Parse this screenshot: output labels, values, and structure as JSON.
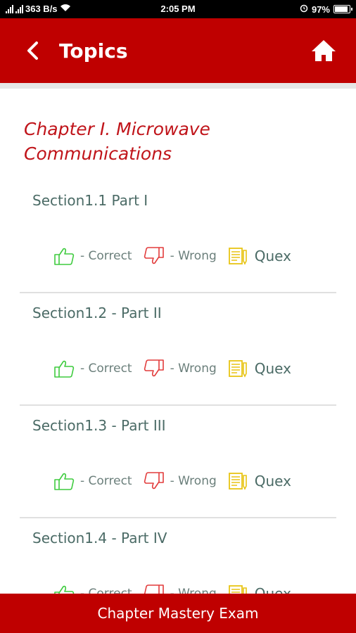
{
  "status_bar": {
    "network_speed": "363 B/s",
    "time": "2:05 PM",
    "battery_percent": "97%",
    "battery_level": 0.97
  },
  "header": {
    "title": "Topics",
    "back_icon": "chevron-left-icon",
    "home_icon": "home-icon"
  },
  "chapter": {
    "title": "Chapter I. Microwave Communications"
  },
  "sections": [
    {
      "title": "Section1.1 Part I",
      "correct_label": "- Correct",
      "wrong_label": "- Wrong",
      "quex_label": "Quex"
    },
    {
      "title": "Section1.2 - Part II",
      "correct_label": "- Correct",
      "wrong_label": "- Wrong",
      "quex_label": "Quex"
    },
    {
      "title": "Section1.3 - Part III",
      "correct_label": "- Correct",
      "wrong_label": "- Wrong",
      "quex_label": "Quex"
    },
    {
      "title": "Section1.4 - Part IV",
      "correct_label": "- Correct",
      "wrong_label": "- Wrong",
      "quex_label": "Quex"
    }
  ],
  "footer": {
    "button_label": "Chapter Mastery Exam"
  },
  "colors": {
    "brand_red": "#bf0000",
    "chapter_text": "#c0141a",
    "correct_green": "#3ecb3e",
    "wrong_red": "#e23c3c",
    "quex_yellow": "#e8c414"
  }
}
